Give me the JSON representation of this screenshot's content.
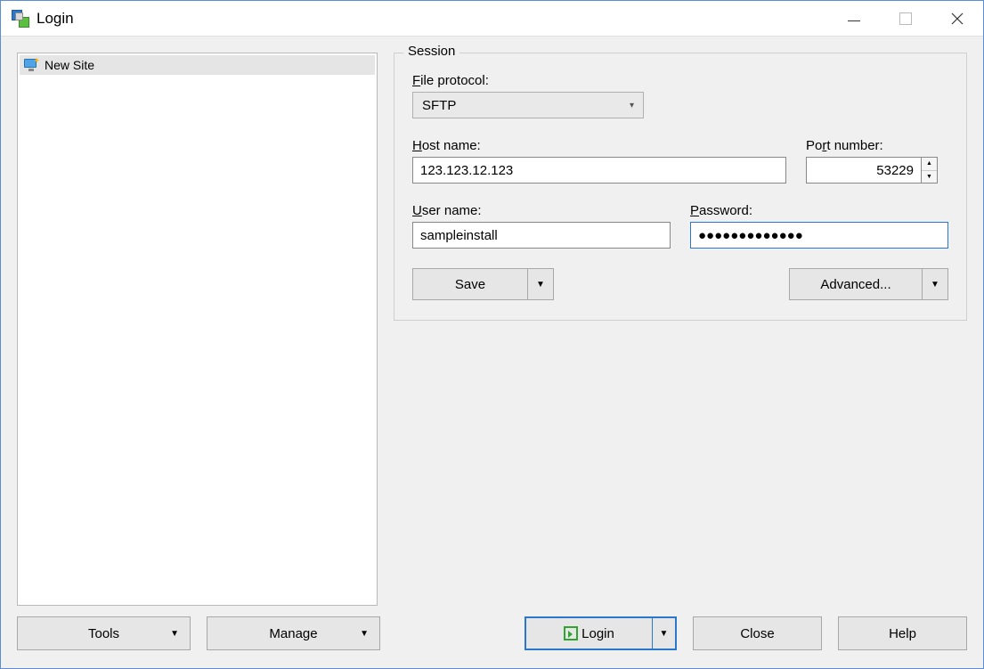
{
  "window": {
    "title": "Login"
  },
  "sites": {
    "items": [
      {
        "label": "New Site",
        "selected": true
      }
    ]
  },
  "session": {
    "legend": "Session",
    "file_protocol_label": "File protocol:",
    "file_protocol_value": "SFTP",
    "host_name_label": "Host name:",
    "host_name_value": "123.123.12.123",
    "port_label": "Port number:",
    "port_value": "53229",
    "user_label": "User name:",
    "user_value": "sampleinstall",
    "password_label": "Password:",
    "password_value": "●●●●●●●●●●●●●",
    "save_label": "Save",
    "advanced_label": "Advanced..."
  },
  "footer": {
    "tools_label": "Tools",
    "manage_label": "Manage",
    "login_label": "Login",
    "close_label": "Close",
    "help_label": "Help"
  }
}
